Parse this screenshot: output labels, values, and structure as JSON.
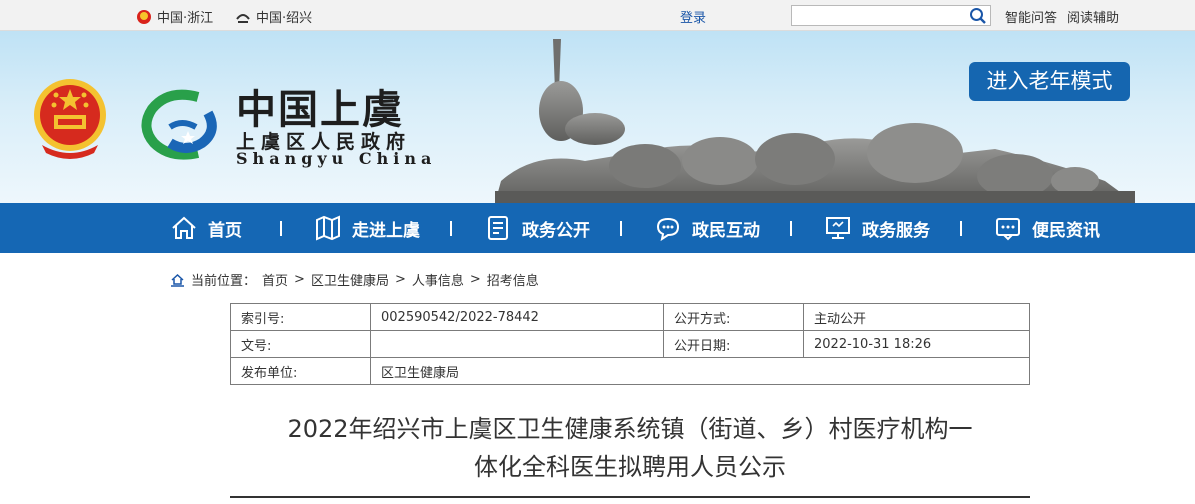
{
  "topbar": {
    "links": [
      {
        "label": "中国·浙江",
        "icon": "zhejiang-emblem-icon"
      },
      {
        "label": "中国·绍兴",
        "icon": "shaoxing-logo-icon"
      }
    ],
    "login_label": "登录",
    "search_placeholder": "",
    "right_links": [
      "智能问答",
      "阅读辅助"
    ]
  },
  "banner": {
    "site_title": "中国上虞",
    "site_subtitle": "上虞区人民政府",
    "site_english": "Shangyu China",
    "elder_mode_label": "进入老年模式"
  },
  "nav": {
    "items": [
      {
        "label": "首页",
        "icon": "home-icon"
      },
      {
        "label": "走进上虞",
        "icon": "map-icon"
      },
      {
        "label": "政务公开",
        "icon": "document-icon"
      },
      {
        "label": "政民互动",
        "icon": "chat-icon"
      },
      {
        "label": "政务服务",
        "icon": "monitor-icon"
      },
      {
        "label": "便民资讯",
        "icon": "message-icon"
      }
    ],
    "separator": "|"
  },
  "breadcrumb": {
    "prefix": "当前位置：",
    "items": [
      "首页",
      "区卫生健康局",
      "人事信息",
      "招考信息"
    ],
    "separator": ">"
  },
  "meta": {
    "index_label": "索引号:",
    "index_value": "002590542/2022-78442",
    "open_mode_label": "公开方式:",
    "open_mode_value": "主动公开",
    "doc_no_label": "文号:",
    "doc_no_value": "",
    "open_date_label": "公开日期:",
    "open_date_value": "2022-10-31 18:26",
    "publisher_label": "发布单位:",
    "publisher_value": "区卫生健康局"
  },
  "article": {
    "title_line1": "2022年绍兴市上虞区卫生健康系统镇（街道、乡）村医疗机构一",
    "title_line2": "体化全科医生拟聘用人员公示"
  },
  "colors": {
    "brand_blue": "#1567b4",
    "elder_button": "#1566b0",
    "link_blue": "#1a56a8"
  }
}
